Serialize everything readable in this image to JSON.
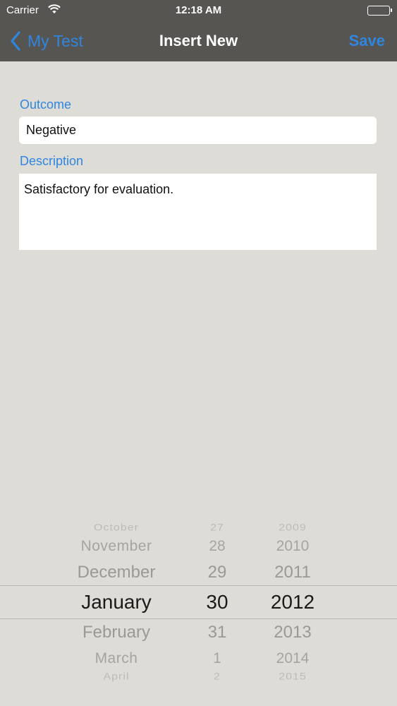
{
  "status_bar": {
    "carrier": "Carrier",
    "time": "12:18 AM"
  },
  "nav": {
    "back_label": "My Test",
    "title": "Insert New",
    "save_label": "Save"
  },
  "form": {
    "outcome_label": "Outcome",
    "outcome_value": "Negative",
    "description_label": "Description",
    "description_value": "Satisfactory for evaluation."
  },
  "date_picker": {
    "months": [
      "October",
      "November",
      "December",
      "January",
      "February",
      "March",
      "April"
    ],
    "days": [
      "27",
      "28",
      "29",
      "30",
      "31",
      "1",
      "2"
    ],
    "years": [
      "2009",
      "2010",
      "2011",
      "2012",
      "2013",
      "2014",
      "2015"
    ],
    "selected_month": "January",
    "selected_day": "30",
    "selected_year": "2012"
  },
  "colors": {
    "accent": "#2f86df",
    "nav_background": "#575552",
    "page_background": "#dedcd7"
  }
}
